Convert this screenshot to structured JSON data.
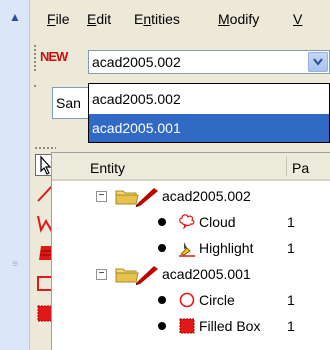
{
  "menubar": {
    "items": [
      {
        "label": "File",
        "accel": "F",
        "rest": "ile"
      },
      {
        "label": "Edit",
        "accel": "E",
        "rest": "dit"
      },
      {
        "label": "Entities",
        "accel": "n",
        "pre": "E",
        "rest": "tities"
      },
      {
        "label": "Modify",
        "accel": "M",
        "rest": "odify"
      },
      {
        "label": "V",
        "accel": "V",
        "rest": ""
      }
    ]
  },
  "toolbar": {
    "new_icon": "NEW",
    "drawing_combo_value": "acad2005.002",
    "font_combo_value": "San"
  },
  "dropdown": {
    "options": [
      "acad2005.002",
      "acad2005.001"
    ],
    "selected_index": 1
  },
  "tree": {
    "columns": [
      "Entity",
      "Pa"
    ],
    "rows": [
      {
        "kind": "drawing",
        "label": "acad2005.002",
        "expander": "−"
      },
      {
        "kind": "entity",
        "icon": "cloud-icon",
        "label": "Cloud",
        "value": "1"
      },
      {
        "kind": "entity",
        "icon": "highlight-icon",
        "label": "Highlight",
        "value": "1"
      },
      {
        "kind": "drawing",
        "label": "acad2005.001",
        "expander": "−"
      },
      {
        "kind": "entity",
        "icon": "circle-icon",
        "label": "Circle",
        "value": "1"
      },
      {
        "kind": "entity",
        "icon": "filled-box-icon",
        "label": "Filled Box",
        "value": "1"
      }
    ]
  },
  "tool_icons": [
    "pointer-icon",
    "line-icon",
    "polyline-icon",
    "hatch-icon",
    "rectangle-icon",
    "filled-box-icon"
  ],
  "colors": {
    "accent_red": "#d01010",
    "selection_blue": "#316ac5",
    "background": "#ece9d8"
  }
}
